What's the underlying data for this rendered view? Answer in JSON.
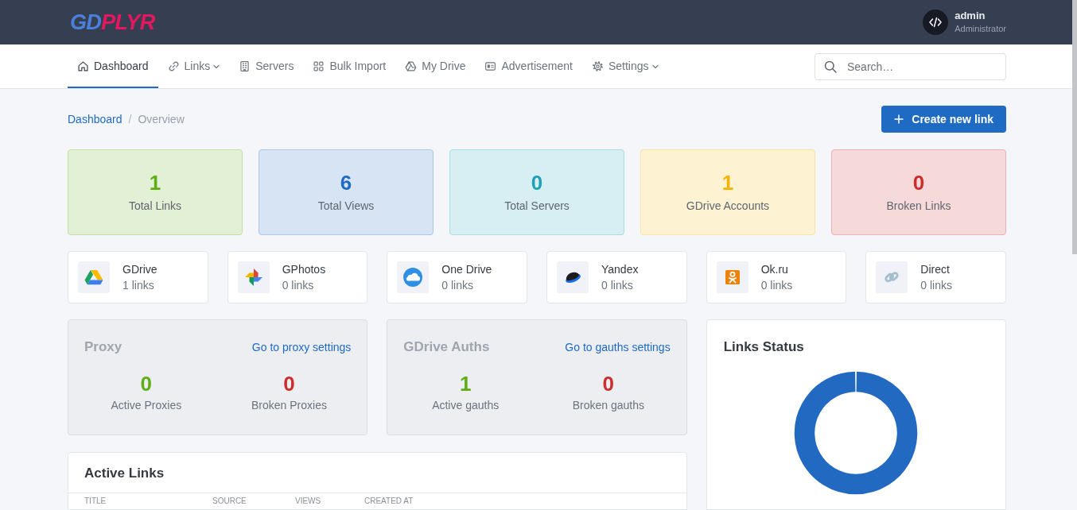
{
  "header": {
    "logo": [
      {
        "text": "GD",
        "color": "#4b80d9"
      },
      {
        "text": "PLYR",
        "color": "#e6175f"
      }
    ],
    "user": {
      "name": "admin",
      "role": "Administrator"
    }
  },
  "nav": {
    "items": [
      {
        "label": "Dashboard",
        "selected": true,
        "dropdown": false
      },
      {
        "label": "Links",
        "selected": false,
        "dropdown": true
      },
      {
        "label": "Servers",
        "selected": false,
        "dropdown": false
      },
      {
        "label": "Bulk Import",
        "selected": false,
        "dropdown": false
      },
      {
        "label": "My Drive",
        "selected": false,
        "dropdown": false
      },
      {
        "label": "Advertisement",
        "selected": false,
        "dropdown": false
      },
      {
        "label": "Settings",
        "selected": false,
        "dropdown": true
      }
    ],
    "search": {
      "placeholder": "Search…"
    }
  },
  "breadcrumb": {
    "items": [
      {
        "label": "Dashboard",
        "kind": "link"
      },
      {
        "label": "Overview",
        "kind": "current"
      }
    ],
    "separator": "/"
  },
  "create_button": {
    "label": "Create new link"
  },
  "stats": [
    {
      "value": "1",
      "label": "Total Links",
      "color": "#5fae16"
    },
    {
      "value": "6",
      "label": "Total Views",
      "color": "#1f6bc4"
    },
    {
      "value": "0",
      "label": "Total Servers",
      "color": "#1fa2b5"
    },
    {
      "value": "1",
      "label": "GDrive Accounts",
      "color": "#f4b400"
    },
    {
      "value": "0",
      "label": "Broken Links",
      "color": "#cc2e2e"
    }
  ],
  "sources": [
    {
      "name": "GDrive",
      "count": "1 links"
    },
    {
      "name": "GPhotos",
      "count": "0 links"
    },
    {
      "name": "One Drive",
      "count": "0 links"
    },
    {
      "name": "Yandex",
      "count": "0 links"
    },
    {
      "name": "Ok.ru",
      "count": "0 links"
    },
    {
      "name": "Direct",
      "count": "0 links"
    }
  ],
  "panels": [
    {
      "title": "Proxy",
      "link": "Go to proxy settings",
      "metrics": [
        {
          "value": "0",
          "label": "Active Proxies",
          "kind": "active"
        },
        {
          "value": "0",
          "label": "Broken Proxies",
          "kind": "broken"
        }
      ]
    },
    {
      "title": "GDrive Auths",
      "link": "Go to gauths settings",
      "metrics": [
        {
          "value": "1",
          "label": "Active gauths",
          "kind": "active"
        },
        {
          "value": "0",
          "label": "Broken gauths",
          "kind": "broken"
        }
      ]
    }
  ],
  "active_links": {
    "title": "Active Links",
    "columns": [
      "TITLE",
      "SOURCE",
      "VIEWS",
      "CREATED AT"
    ]
  },
  "links_status": {
    "title": "Links Status"
  }
}
